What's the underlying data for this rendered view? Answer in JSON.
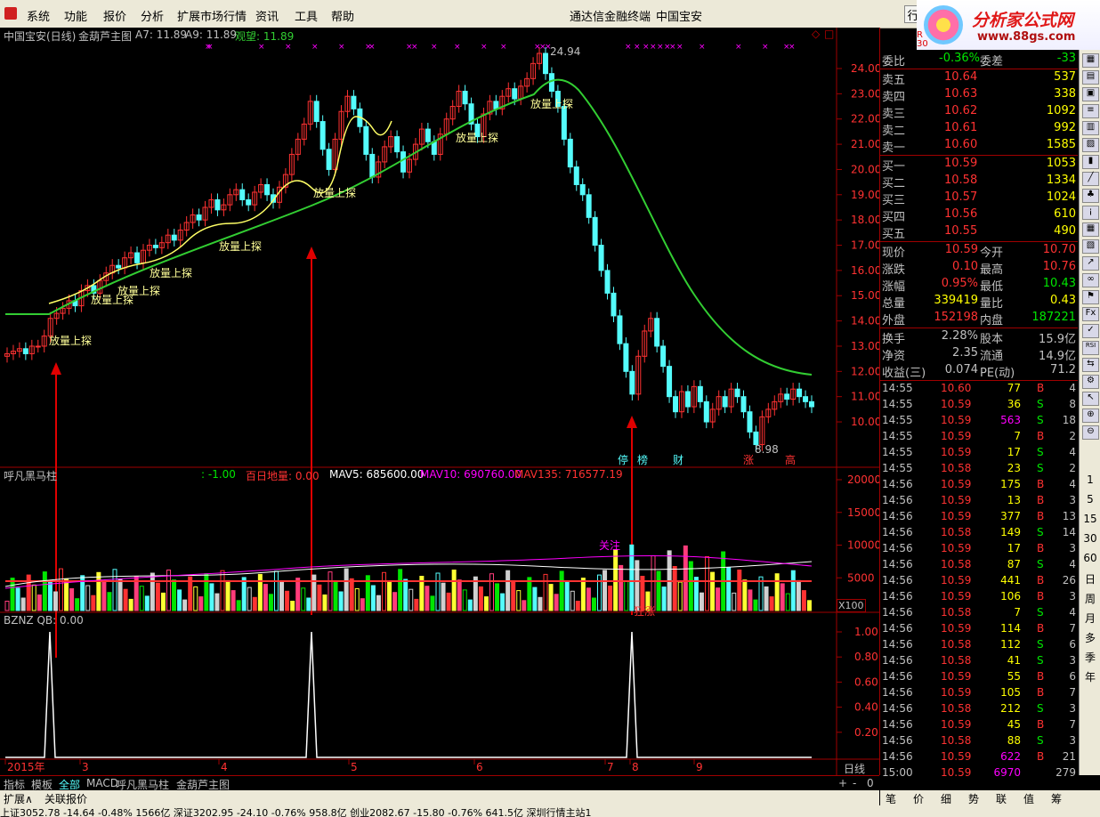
{
  "menu": {
    "items": [
      "系统",
      "功能",
      "报价",
      "分析",
      "扩展市场行情",
      "资讯",
      "工具",
      "帮助"
    ],
    "center_title": "通达信金融终端",
    "stock_title": "中国宝安",
    "right_btn": "行"
  },
  "logo": {
    "title": "分析家公式网",
    "url": "www.88gs.com",
    "r_label": "R",
    "r_num": "30"
  },
  "main_chart": {
    "header": {
      "stock": "中国宝安(日线)",
      "formula": "金葫芦主图",
      "a7": "A7: 11.89",
      "a9": "A9: 11.89",
      "guan": "观望: 11.89"
    },
    "y_ticks": [
      "24.00",
      "23.00",
      "22.00",
      "21.00",
      "20.00",
      "19.00",
      "18.00",
      "17.00",
      "16.00",
      "15.00",
      "14.00",
      "13.00",
      "12.00",
      "11.00",
      "10.00"
    ],
    "high_label": "24.94",
    "low_label": "8.98",
    "signal_text": "放量上探",
    "bottom_tags": [
      "停",
      "榜",
      "财",
      "涨",
      "高"
    ]
  },
  "vol_panel": {
    "title": "呼凡黑马柱",
    "v1": ": -1.00",
    "baiyi": "百日地量: 0.00",
    "mav5": "MAV5: 685600.00",
    "mav10": "MAV10: 690760.00",
    "mav135": "MAV135: 716577.19",
    "y_ticks": [
      "20000",
      "15000",
      "10000",
      "5000"
    ],
    "x100": "X100",
    "guanzhu": "关注",
    "luanzhang": "狂涨"
  },
  "bznz_panel": {
    "title": "BZNZ QB: 0.00",
    "y_ticks": [
      "1.00",
      "0.80",
      "0.60",
      "0.40",
      "0.20"
    ]
  },
  "x_axis": {
    "labels": [
      "2015年",
      "3",
      "4",
      "5",
      "6",
      "7",
      "8",
      "9"
    ],
    "period": "日线"
  },
  "quote": {
    "weibi": {
      "label": "委比",
      "value": "-0.36%",
      "label2": "委差",
      "value2": "-33"
    },
    "sells": [
      {
        "label": "卖五",
        "price": "10.64",
        "vol": "537"
      },
      {
        "label": "卖四",
        "price": "10.63",
        "vol": "338"
      },
      {
        "label": "卖三",
        "price": "10.62",
        "vol": "1092"
      },
      {
        "label": "卖二",
        "price": "10.61",
        "vol": "992"
      },
      {
        "label": "卖一",
        "price": "10.60",
        "vol": "1585"
      }
    ],
    "buys": [
      {
        "label": "买一",
        "price": "10.59",
        "vol": "1053"
      },
      {
        "label": "买二",
        "price": "10.58",
        "vol": "1334"
      },
      {
        "label": "买三",
        "price": "10.57",
        "vol": "1024"
      },
      {
        "label": "买四",
        "price": "10.56",
        "vol": "610"
      },
      {
        "label": "买五",
        "price": "10.55",
        "vol": "490"
      }
    ],
    "stats1": [
      {
        "l1": "现价",
        "v1": "10.59",
        "l2": "今开",
        "v2": "10.70"
      },
      {
        "l1": "涨跌",
        "v1": "0.10",
        "l2": "最高",
        "v2": "10.76"
      },
      {
        "l1": "涨幅",
        "v1": "0.95%",
        "l2": "最低",
        "v2": "10.43"
      },
      {
        "l1": "总量",
        "v1": "339419",
        "l2": "量比",
        "v2": "0.43"
      },
      {
        "l1": "外盘",
        "v1": "152198",
        "l2": "内盘",
        "v2": "187221"
      }
    ],
    "stats2": [
      {
        "l1": "换手",
        "v1": "2.28%",
        "l2": "股本",
        "v2": "15.9亿"
      },
      {
        "l1": "净资",
        "v1": "2.35",
        "l2": "流通",
        "v2": "14.9亿"
      },
      {
        "l1": "收益(三)",
        "v1": "0.074",
        "l2": "PE(动)",
        "v2": "71.2"
      }
    ],
    "ticks": [
      {
        "t": "14:55",
        "p": "10.60",
        "v": "77",
        "bs": "B",
        "n": "4"
      },
      {
        "t": "14:55",
        "p": "10.59",
        "v": "36",
        "bs": "S",
        "n": "8"
      },
      {
        "t": "14:55",
        "p": "10.59",
        "v": "563",
        "bs": "S",
        "n": "18"
      },
      {
        "t": "14:55",
        "p": "10.59",
        "v": "7",
        "bs": "B",
        "n": "2"
      },
      {
        "t": "14:55",
        "p": "10.59",
        "v": "17",
        "bs": "S",
        "n": "4"
      },
      {
        "t": "14:55",
        "p": "10.58",
        "v": "23",
        "bs": "S",
        "n": "2"
      },
      {
        "t": "14:56",
        "p": "10.59",
        "v": "175",
        "bs": "B",
        "n": "4"
      },
      {
        "t": "14:56",
        "p": "10.59",
        "v": "13",
        "bs": "B",
        "n": "3"
      },
      {
        "t": "14:56",
        "p": "10.59",
        "v": "377",
        "bs": "B",
        "n": "13"
      },
      {
        "t": "14:56",
        "p": "10.58",
        "v": "149",
        "bs": "S",
        "n": "14"
      },
      {
        "t": "14:56",
        "p": "10.59",
        "v": "17",
        "bs": "B",
        "n": "3"
      },
      {
        "t": "14:56",
        "p": "10.58",
        "v": "87",
        "bs": "S",
        "n": "4"
      },
      {
        "t": "14:56",
        "p": "10.59",
        "v": "441",
        "bs": "B",
        "n": "26"
      },
      {
        "t": "14:56",
        "p": "10.59",
        "v": "106",
        "bs": "B",
        "n": "3"
      },
      {
        "t": "14:56",
        "p": "10.58",
        "v": "7",
        "bs": "S",
        "n": "4"
      },
      {
        "t": "14:56",
        "p": "10.59",
        "v": "114",
        "bs": "B",
        "n": "7"
      },
      {
        "t": "14:56",
        "p": "10.58",
        "v": "112",
        "bs": "S",
        "n": "6"
      },
      {
        "t": "14:56",
        "p": "10.58",
        "v": "41",
        "bs": "S",
        "n": "3"
      },
      {
        "t": "14:56",
        "p": "10.59",
        "v": "55",
        "bs": "B",
        "n": "6"
      },
      {
        "t": "14:56",
        "p": "10.59",
        "v": "105",
        "bs": "B",
        "n": "7"
      },
      {
        "t": "14:56",
        "p": "10.58",
        "v": "212",
        "bs": "S",
        "n": "3"
      },
      {
        "t": "14:56",
        "p": "10.59",
        "v": "45",
        "bs": "B",
        "n": "7"
      },
      {
        "t": "14:56",
        "p": "10.58",
        "v": "88",
        "bs": "S",
        "n": "3"
      },
      {
        "t": "14:56",
        "p": "10.59",
        "v": "622",
        "bs": "B",
        "n": "21"
      },
      {
        "t": "15:00",
        "p": "10.59",
        "v": "6970",
        "bs": "",
        "n": "279"
      }
    ]
  },
  "icons": {
    "labels": [
      "1",
      "5",
      "15",
      "30",
      "60",
      "日",
      "周",
      "月",
      "多",
      "季",
      "年"
    ]
  },
  "tabs": {
    "row1": [
      "指标",
      "模板",
      "全部",
      "MACD",
      "呼凡黑马柱",
      "金葫芦主图"
    ],
    "row2": [
      "扩展∧",
      "关联报价"
    ],
    "right": [
      "笔",
      "价",
      "细",
      "势",
      "联",
      "值",
      "筹"
    ]
  },
  "status": {
    "text": "上证3052.78  -14.64  -0.48%  1566亿  深证3202.95  -24.10  -0.76%  958.8亿  创业2082.67  -15.80  -0.76%  641.5亿    深圳行情主站1"
  },
  "colors": {
    "up": "#ff3232",
    "down": "#00e600",
    "cyan": "#54fcfc",
    "yellow": "#ffff00",
    "ma": "#32cd32",
    "white": "#ffffff",
    "magenta": "#ff00ff"
  }
}
